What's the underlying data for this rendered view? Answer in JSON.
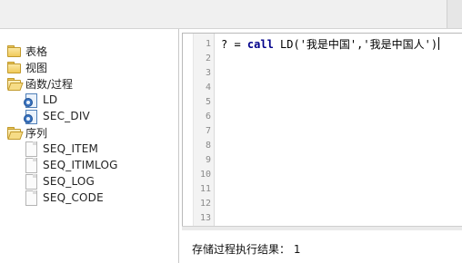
{
  "tree": {
    "items": [
      {
        "label": "表格",
        "icon": "folder-icon"
      },
      {
        "label": "视图",
        "icon": "folder-icon"
      },
      {
        "label": "函数/过程",
        "icon": "folder-open-icon"
      },
      {
        "label": "LD",
        "icon": "function-icon"
      },
      {
        "label": "SEC_DIV",
        "icon": "function-icon"
      },
      {
        "label": "序列",
        "icon": "folder-open-icon"
      },
      {
        "label": "SEQ_ITEM",
        "icon": "sequence-icon"
      },
      {
        "label": "SEQ_ITIMLOG",
        "icon": "sequence-icon"
      },
      {
        "label": "SEQ_LOG",
        "icon": "sequence-icon"
      },
      {
        "label": "SEQ_CODE",
        "icon": "sequence-icon"
      }
    ]
  },
  "editor": {
    "line_numbers": [
      "1",
      "2",
      "3",
      "4",
      "5",
      "6",
      "7",
      "8",
      "9",
      "10",
      "11",
      "12",
      "13"
    ],
    "code": {
      "prefix": "? = ",
      "keyword": "call",
      "rest": " LD('我是中国','我是中国人')"
    }
  },
  "result": {
    "label": "存储过程执行结果：",
    "value": "1"
  }
}
